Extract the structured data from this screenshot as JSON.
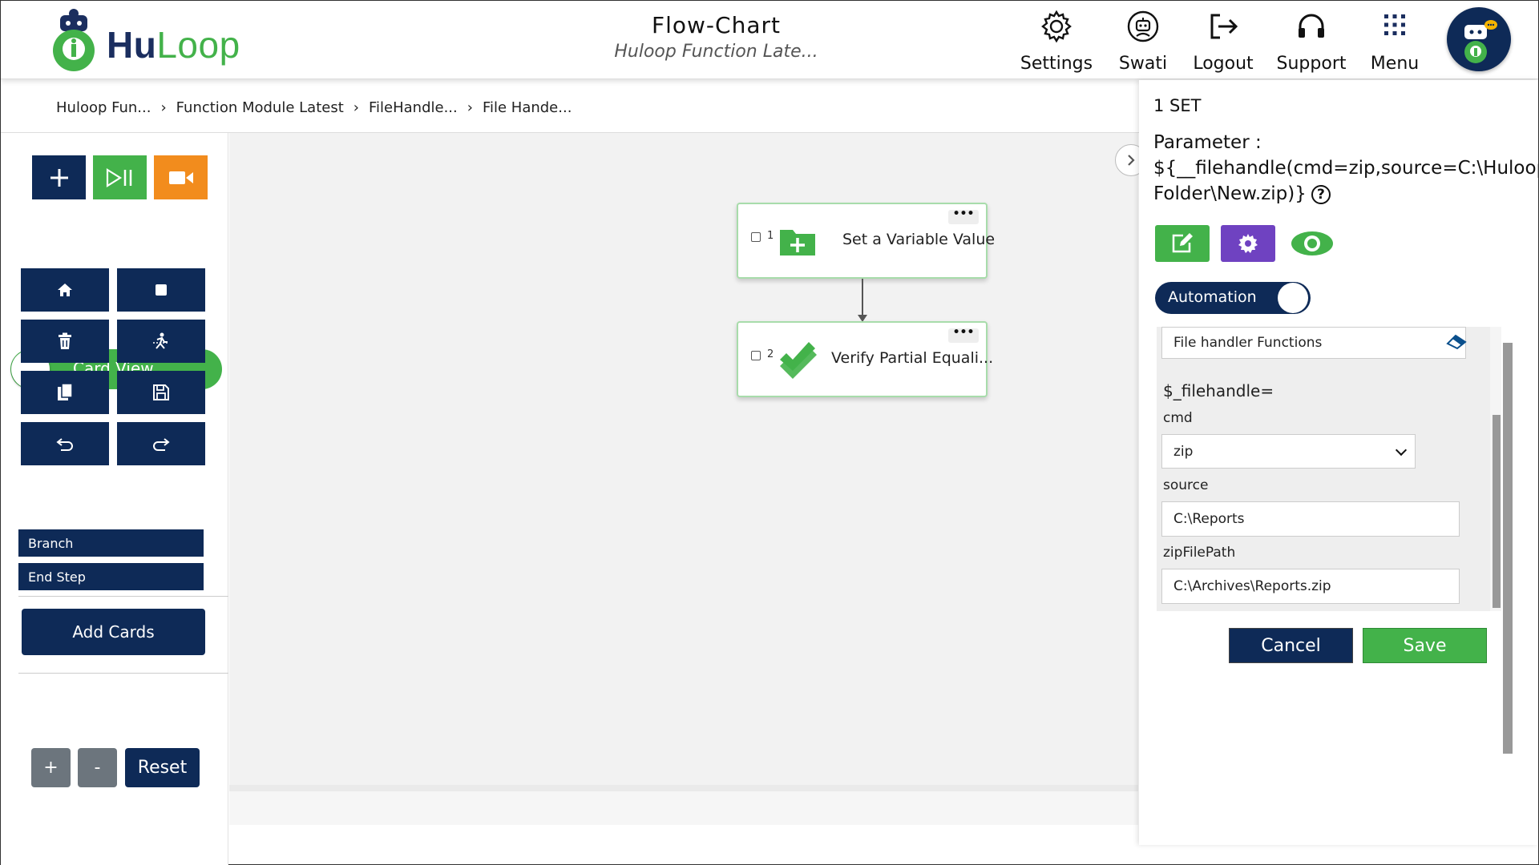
{
  "app": {
    "logo_hu": "Hu",
    "logo_loop": "Loop",
    "title": "Flow-Chart",
    "subtitle": "Huloop Function Late..."
  },
  "nav": {
    "items": [
      {
        "label": "Settings",
        "icon": "gear-icon"
      },
      {
        "label": "Swati",
        "icon": "user-robot-icon"
      },
      {
        "label": "Logout",
        "icon": "logout-icon"
      },
      {
        "label": "Support",
        "icon": "headset-icon"
      },
      {
        "label": "Menu",
        "icon": "grid-menu-icon"
      }
    ]
  },
  "breadcrumb": [
    "Huloop Fun...",
    "Function Module Latest",
    "FileHandle...",
    "File Hande..."
  ],
  "left": {
    "toggle_label": "Card View",
    "add_cards": "Add Cards",
    "list": [
      "Branch",
      "End Step"
    ],
    "zoom_in": "+",
    "zoom_out": "-",
    "reset": "Reset"
  },
  "cards": [
    {
      "num": "1",
      "label": "Set a Variable Value",
      "icon": "folder-plus-icon"
    },
    {
      "num": "2",
      "label": "Verify Partial Equali...",
      "icon": "double-check-icon"
    }
  ],
  "panel": {
    "set_title": "1 SET",
    "param_label": "Parameter :",
    "param_line1": "${__filehandle(cmd=zip,source=C:\\Huloop\\",
    "param_line2": "Folder\\New.zip)}",
    "help": "?",
    "automation_label": "Automation",
    "function_group": "File handler Functions",
    "func_prefix": "$_filehandle=",
    "fields": [
      {
        "label": "cmd",
        "value": "zip"
      },
      {
        "label": "source",
        "value": "C:\\Reports"
      },
      {
        "label": "zipFilePath",
        "value": "C:\\Archives\\Reports.zip"
      }
    ],
    "cancel": "Cancel",
    "save": "Save"
  },
  "colors": {
    "navy": "#0e2a57",
    "green": "#43b24a",
    "orange": "#f28c1d",
    "purple": "#6f42c1",
    "gray": "#6c757d"
  }
}
